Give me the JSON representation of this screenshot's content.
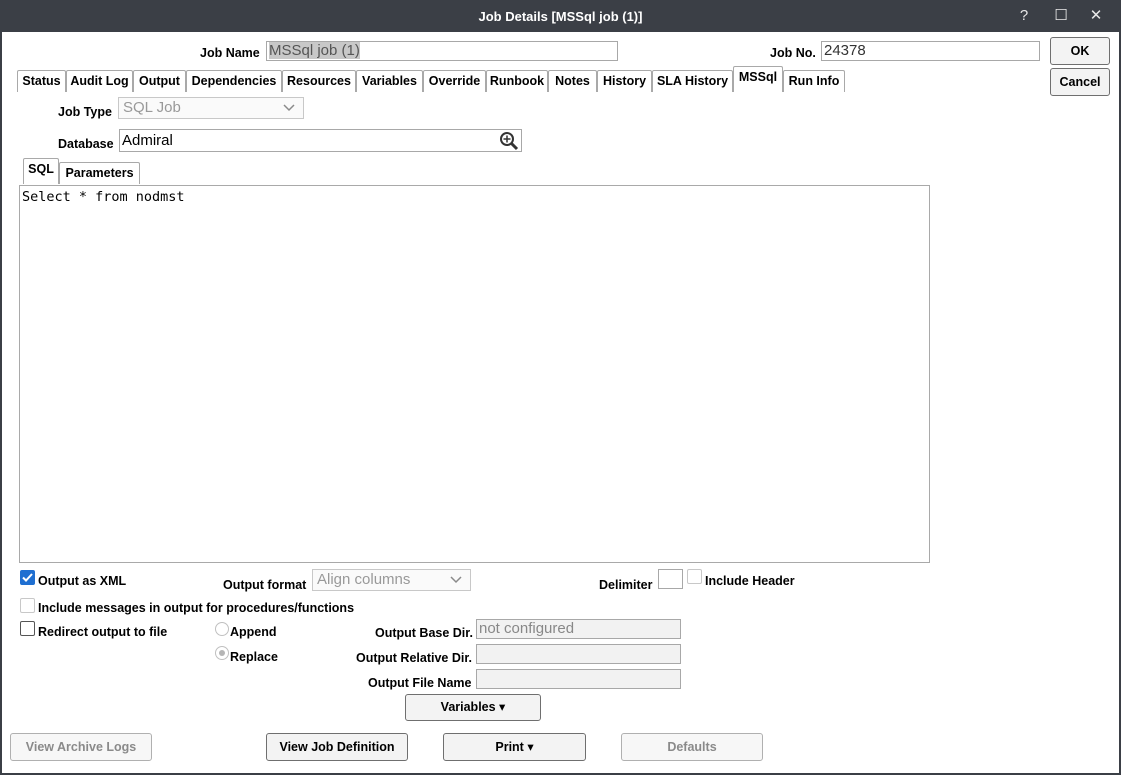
{
  "window": {
    "title": "Job Details [MSSql job (1)]",
    "controls": {
      "help": "?",
      "maximize": "☐",
      "close": "✕"
    }
  },
  "header": {
    "job_name_label": "Job Name",
    "job_name_value": "MSSql job (1)",
    "job_no_label": "Job No.",
    "job_no_value": "24378",
    "ok_label": "OK",
    "cancel_label": "Cancel"
  },
  "tabs": [
    {
      "label": "Status"
    },
    {
      "label": "Audit Log"
    },
    {
      "label": "Output"
    },
    {
      "label": "Dependencies"
    },
    {
      "label": "Resources"
    },
    {
      "label": "Variables"
    },
    {
      "label": "Override"
    },
    {
      "label": "Runbook"
    },
    {
      "label": "Notes"
    },
    {
      "label": "History"
    },
    {
      "label": "SLA History"
    },
    {
      "label": "MSSql",
      "selected": true
    },
    {
      "label": "Run Info"
    }
  ],
  "mssql": {
    "job_type_label": "Job Type",
    "job_type_value": "SQL Job",
    "database_label": "Database",
    "database_value": "Admiral",
    "subtabs": [
      {
        "label": "SQL",
        "selected": true
      },
      {
        "label": "Parameters"
      }
    ],
    "sql_text": "Select * from nodmst",
    "output_as_xml_label": "Output as XML",
    "output_as_xml_checked": true,
    "output_format_label": "Output format",
    "output_format_value": "Align columns",
    "delimiter_label": "Delimiter",
    "include_header_label": "Include Header",
    "include_messages_label": "Include messages in output for procedures/functions",
    "redirect_label": "Redirect output to file",
    "append_label": "Append",
    "replace_label": "Replace",
    "base_dir_label": "Output Base Dir.",
    "base_dir_value": "not configured",
    "relative_dir_label": "Output Relative Dir.",
    "file_name_label": "Output File Name",
    "variables_button": "Variables ▾"
  },
  "footer": {
    "view_archive_logs": "View Archive Logs",
    "view_job_definition": "View Job Definition",
    "print": "Print ▾",
    "defaults": "Defaults"
  },
  "colors": {
    "titlebar": "#3b3f46",
    "checkbox_accent": "#1f6fd1",
    "selection_highlight": "#c8c8c8"
  }
}
